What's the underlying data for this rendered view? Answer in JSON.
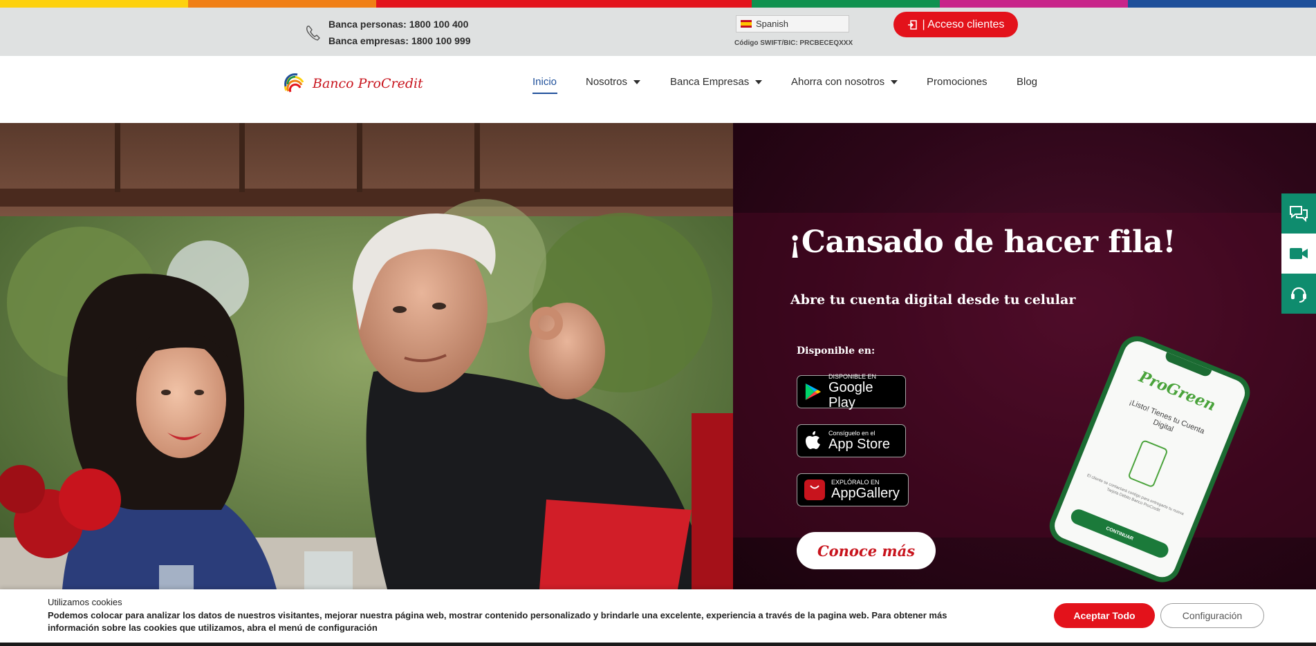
{
  "stripe_colors": [
    "#fdd10e",
    "#f07f15",
    "#e3141c",
    "#e3141c",
    "#10914f",
    "#c8258a",
    "#1e4f9a"
  ],
  "topbar": {
    "phone_personas": "Banca personas: 1800 100 400",
    "phone_empresas": "Banca empresas: 1800 100 999",
    "language": "Spanish",
    "swift": "Código SWIFT/BIC: PRCBECEQXXX",
    "access_label": "| Acceso clientes"
  },
  "nav": {
    "logo_text": "Banco ProCredit",
    "items": [
      {
        "label": "Inicio"
      },
      {
        "label": "Nosotros"
      },
      {
        "label": "Banca Empresas"
      },
      {
        "label": "Ahorra con nosotros"
      },
      {
        "label": "Promociones"
      },
      {
        "label": "Blog"
      }
    ]
  },
  "hero": {
    "title": "¡Cansado de hacer fila!",
    "subtitle": "Abre tu cuenta digital desde tu celular",
    "available": "Disponible en:",
    "badges": [
      {
        "small": "DISPONIBLE EN",
        "big": "Google Play"
      },
      {
        "small": "Consíguelo en el",
        "big": "App Store"
      },
      {
        "small": "EXPLÓRALO EN",
        "big": "AppGallery"
      }
    ],
    "cta": "Conoce más",
    "phone": {
      "brand": "ProGreen",
      "message": "¡Listo! Tienes tu Cuenta Digital",
      "fine_print": "El cliente se contactará contigo para entregarte tu nueva Tarjeta Débito Banco ProCredit",
      "button": "CONTINUAR"
    }
  },
  "cookies": {
    "title": "Utilizamos cookies",
    "text": "Podemos colocar para analizar los datos de nuestros visitantes, mejorar nuestra página web, mostrar contenido personalizado y brindarle una excelente, experiencia a través de la pagina web. Para obtener más información sobre las cookies que utilizamos, abra el menú de configuración",
    "accept": "Aceptar Todo",
    "config": "Configuración"
  },
  "colors": {
    "brand_red": "#e3121b",
    "nav_active": "#1e4f9a",
    "widget_green": "#0f8c6e"
  }
}
